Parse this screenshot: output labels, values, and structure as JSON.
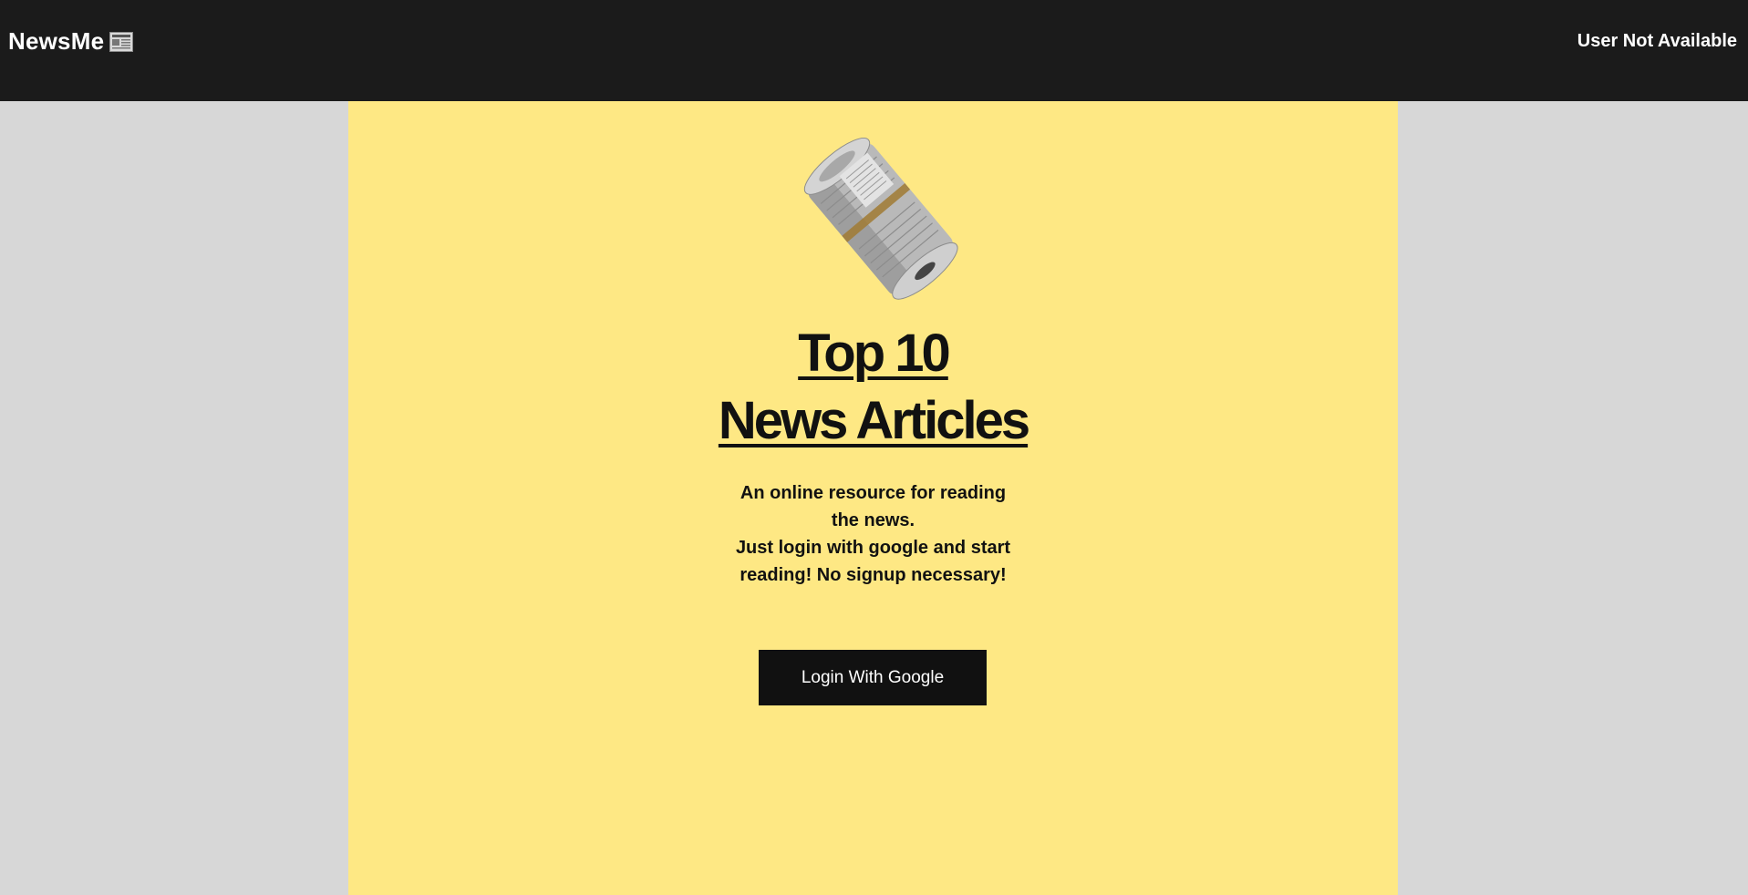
{
  "header": {
    "brand": "NewsMe",
    "brand_icon": "newspaper-icon",
    "user_status": "User Not Available"
  },
  "hero": {
    "image": "rolled-newspaper-image",
    "title_line1": "Top 10",
    "title_line2": "News Articles",
    "description_1": "An online resource for reading the news.",
    "description_2": "Just login with google and start reading! No signup necessary!",
    "login_button": "Login With Google"
  },
  "colors": {
    "header_bg": "#1b1b1b",
    "page_bg": "#d7d7d7",
    "panel_bg": "#fee884",
    "button_bg": "#111111",
    "text_dark": "#111111"
  }
}
